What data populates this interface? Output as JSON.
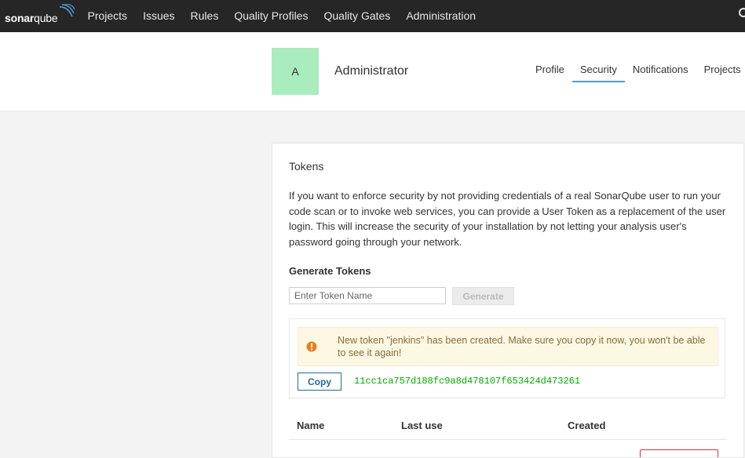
{
  "nav": {
    "logo_bold": "sonar",
    "logo_light": "qube",
    "items": [
      "Projects",
      "Issues",
      "Rules",
      "Quality Profiles",
      "Quality Gates",
      "Administration"
    ]
  },
  "profile": {
    "avatar_letter": "A",
    "name": "Administrator",
    "tabs": [
      "Profile",
      "Security",
      "Notifications",
      "Projects"
    ],
    "active_tab": "Security"
  },
  "tokens": {
    "title": "Tokens",
    "description": "If you want to enforce security by not providing credentials of a real SonarQube user to run your code scan or to invoke web services, you can provide a User Token as a replacement of the user login. This will increase the security of your installation by not letting your analysis user's password going through your network.",
    "generate_heading": "Generate Tokens",
    "input_placeholder": "Enter Token Name",
    "generate_label": "Generate",
    "alert_message": "New token \"jenkins\" has been created. Make sure you copy it now, you won't be able to see it again!",
    "copy_label": "Copy",
    "token_value": "11cc1ca757d188fc9a8d478107f653424d473261",
    "columns": [
      "Name",
      "Last use",
      "Created"
    ]
  },
  "colors": {
    "topbar": "#262626",
    "avatar_bg": "#a9ecbd",
    "active_tab_underline": "#4b9fd5",
    "alert_bg": "#fcf8e3",
    "alert_icon": "#ed7d20",
    "token_text": "#00aa00",
    "copy_button": "#236a97"
  },
  "icons": {
    "logo_mark": "sonar-waves-icon",
    "alert": "warning-circle-icon",
    "nav_right": "search-icon"
  }
}
